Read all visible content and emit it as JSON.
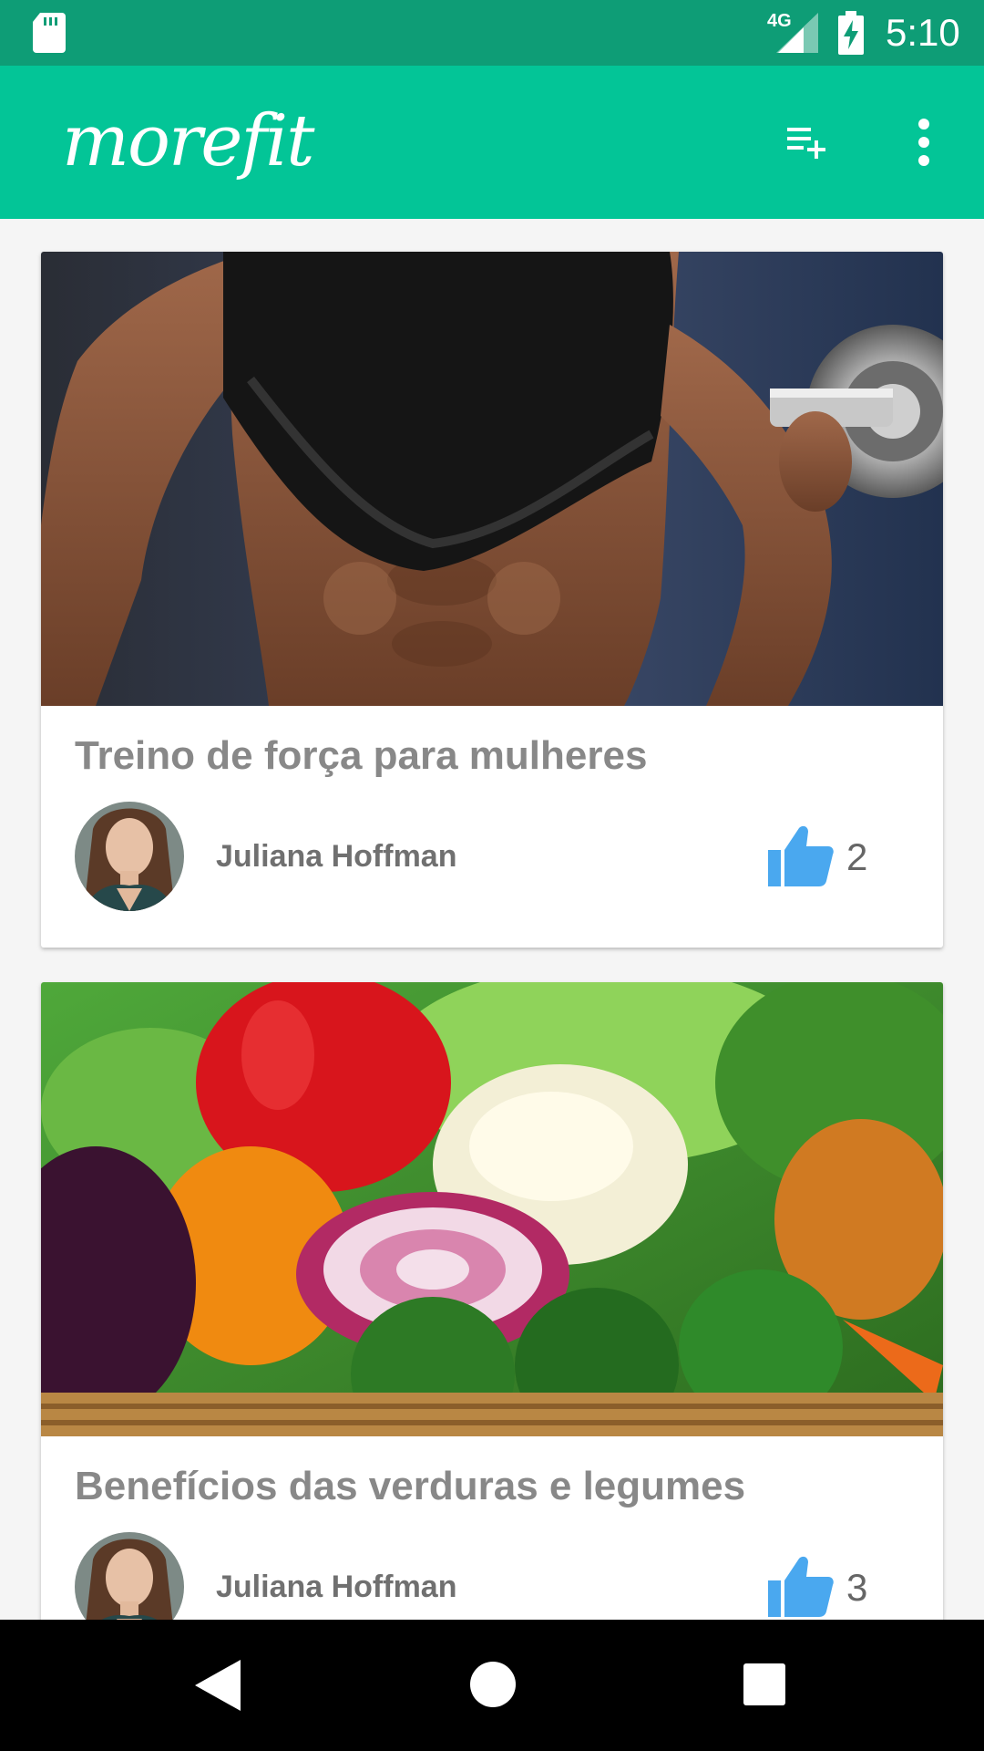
{
  "status_bar": {
    "network": "4G",
    "time": "5:10"
  },
  "toolbar": {
    "logo": "morefit",
    "add_icon": "playlist-add-icon",
    "menu_icon": "more-vert-icon"
  },
  "colors": {
    "status_bar": "#0e9d76",
    "toolbar": "#03c597",
    "like": "#4aa8ef",
    "title_text": "#888888"
  },
  "posts": [
    {
      "title": "Treino de força para mulheres",
      "author": "Juliana Hoffman",
      "likes": "2",
      "image": "fitness-dumbbell-photo"
    },
    {
      "title": "Benefícios das verduras e legumes",
      "author": "Juliana Hoffman",
      "likes": "3",
      "image": "vegetables-basket-photo"
    }
  ],
  "nav": {
    "back_icon": "back-triangle-icon",
    "home_icon": "home-circle-icon",
    "recents_icon": "recents-square-icon"
  }
}
